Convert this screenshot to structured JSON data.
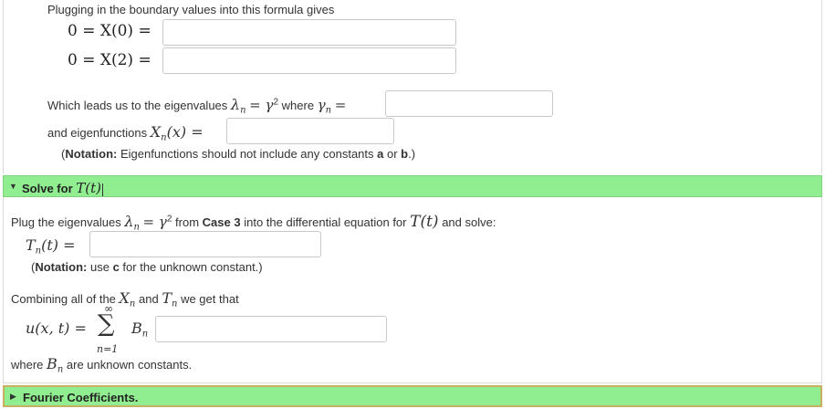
{
  "intro": "Plugging in the boundary values into this formula gives",
  "bc_eq1": "0 = X(0) =",
  "bc_eq2": "0 = X(2) =",
  "eigen_prefix": "Which leads us to the eigenvalues",
  "eigen_lambda": "λ",
  "eigen_sub_n": "n",
  "eigen_equals_gamma": "= γ",
  "eigen_sup2": "2",
  "eigen_where": "where",
  "gamma_label": "γ",
  "gamma_eq": "=",
  "eigenfunc_prefix": "and eigenfunctions",
  "eigenfunc_expr": "X",
  "eigenfunc_tail": "(x) =",
  "note1_bold": "Notation:",
  "note1_text": " Eigenfunctions should not include any constants ",
  "note1_a": "a",
  "note1_or": " or ",
  "note1_b": "b",
  "note1_end": ".)",
  "section_solve_label": "Solve for",
  "section_solve_math": "T(t)",
  "plug_prefix": "Plug the eigenvalues",
  "plug_from": "from",
  "plug_case": "Case 3",
  "plug_middle": "into the differential equation for",
  "plug_T": "T(t)",
  "plug_end": "and solve:",
  "tn_label": "T",
  "tn_tail": "(t) =",
  "note2_bold": "Notation:",
  "note2_text": " use ",
  "note2_c": "c",
  "note2_end": " for the unknown constant.)",
  "combine_prefix": "Combining all of the",
  "combine_X": "X",
  "combine_and": "and",
  "combine_T": "T",
  "combine_end": "we get that",
  "u_expr": "u(x, t) =",
  "sum_top": "∞",
  "sum_sign": "∑",
  "sum_bottom": "n=1",
  "bn_label": "B",
  "where_prefix": "where",
  "where_B": "B",
  "where_end": "are unknown constants.",
  "section_fourier_label": "Fourier Coefficients."
}
